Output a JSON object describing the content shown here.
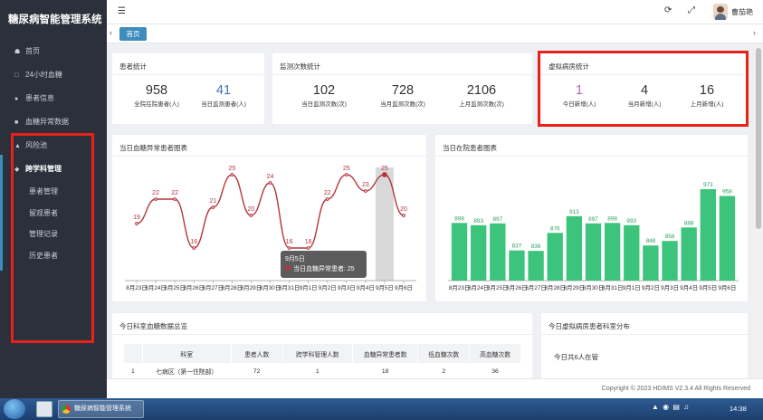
{
  "app": {
    "title": "糖尿病智能管理系统",
    "user_name": "曹茄艳"
  },
  "sidebar": {
    "items": [
      {
        "label": "首页",
        "icon": "home-icon"
      },
      {
        "label": "24小时血糖",
        "icon": "bookmark-icon"
      },
      {
        "label": "患者信息",
        "icon": "user-icon"
      },
      {
        "label": "血糖异常数据",
        "icon": "car-icon"
      },
      {
        "label": "风险池",
        "icon": "warning-icon"
      },
      {
        "label": "跨学科管理",
        "icon": "cube-icon"
      }
    ],
    "subitems": [
      {
        "label": "患者管理"
      },
      {
        "label": "留观患者"
      },
      {
        "label": "管理记录"
      },
      {
        "label": "历史患者"
      }
    ],
    "active_item": "跨学科管理"
  },
  "header": {
    "menu_icon": "hamburger-icon",
    "refresh_icon": "refresh-icon",
    "fullscreen_icon": "expand-icon"
  },
  "tabs": [
    {
      "label": "首页"
    }
  ],
  "patient_stats": {
    "title": "患者统计",
    "stats": [
      {
        "value": "958",
        "label": "全院在院患者(人)"
      },
      {
        "value": "41",
        "label": "当日监测患者(人)"
      }
    ]
  },
  "monitor_stats": {
    "title": "监测次数统计",
    "stats": [
      {
        "value": "102",
        "label": "当日监测次数(次)"
      },
      {
        "value": "728",
        "label": "当月监测次数(次)"
      },
      {
        "value": "2106",
        "label": "上月监测次数(次)"
      }
    ]
  },
  "virtual_ward": {
    "title": "虚拟病房统计",
    "stats": [
      {
        "value": "1",
        "label": "今日新增(人)"
      },
      {
        "value": "4",
        "label": "当月新增(人)"
      },
      {
        "value": "16",
        "label": "上月新增(人)"
      }
    ]
  },
  "line_panel_title": "当日血糖异常患者图表",
  "bar_panel_title": "当日在院患者图表",
  "tooltip": {
    "date": "9月5日",
    "series_label": "当日血糖异常患者:",
    "value": "25"
  },
  "chart_data": [
    {
      "type": "line",
      "title": "当日血糖异常患者图表",
      "categories": [
        "8月23日",
        "8月24日",
        "8月25日",
        "8月26日",
        "8月27日",
        "8月28日",
        "8月29日",
        "8月30日",
        "8月31日",
        "9月1日",
        "9月2日",
        "9月3日",
        "9月4日",
        "9月5日",
        "9月6日"
      ],
      "series": [
        {
          "name": "当日血糖异常患者",
          "values": [
            19,
            22,
            22,
            16,
            21,
            25,
            20,
            24,
            16,
            16,
            22,
            25,
            23,
            25,
            20
          ]
        }
      ],
      "highlight_category": "9月5日",
      "color": "#b5343c"
    },
    {
      "type": "bar",
      "title": "当日在院患者图表",
      "categories": [
        "8月23日",
        "8月24日",
        "8月25日",
        "8月26日",
        "8月27日",
        "8月28日",
        "8月29日",
        "8月30日",
        "8月31日",
        "9月1日",
        "9月2日",
        "9月3日",
        "9月4日",
        "9月5日",
        "9月6日"
      ],
      "values": [
        898,
        893,
        897,
        837,
        836,
        876,
        913,
        897,
        898,
        893,
        848,
        858,
        888,
        973,
        958
      ],
      "color": "#3cc47c"
    }
  ],
  "table": {
    "title": "今日科室血糖数据总览",
    "columns": [
      "",
      "科室",
      "患者人数",
      "跨学科管理人数",
      "血糖异常患者数",
      "低血糖次数",
      "高血糖次数"
    ],
    "rows": [
      [
        "1",
        "七病区（第一住院部）",
        "72",
        "1",
        "18",
        "2",
        "36"
      ]
    ]
  },
  "dept_panel": {
    "title": "今日虚拟病房患者科室分布",
    "summary": "今日共6人在管"
  },
  "footer": {
    "copyright": "Copyright © 2023 HDIMS V2.3.4 All Rights Reserved"
  },
  "taskbar": {
    "task_label": "糖尿病智能管理系统",
    "clock": "14:38"
  },
  "annotation_color": "#e8211a"
}
